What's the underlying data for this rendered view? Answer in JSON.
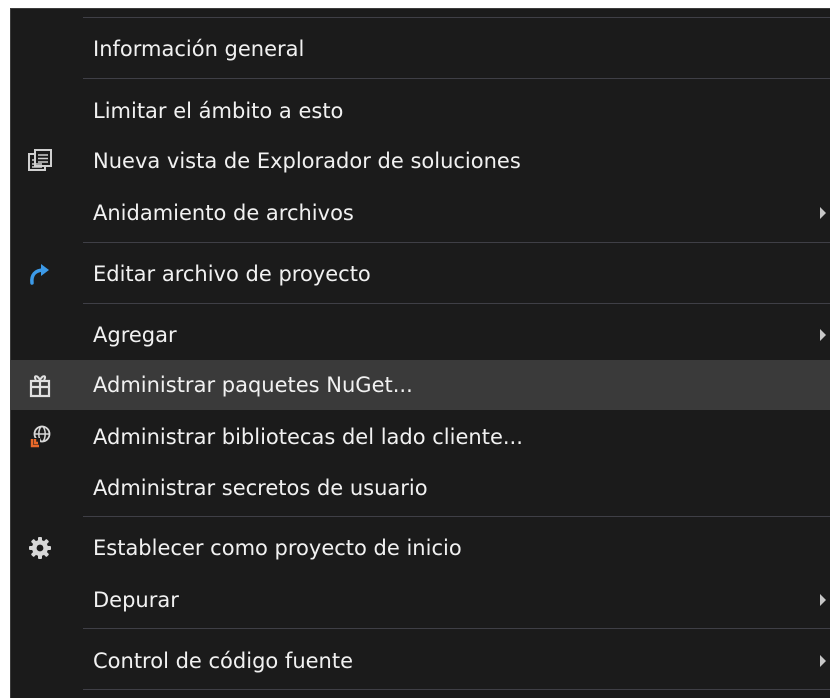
{
  "menu": {
    "items": [
      {
        "label": "Información general"
      },
      {
        "label": "Limitar el ámbito a esto"
      },
      {
        "label": "Nueva vista de Explorador de soluciones",
        "icon": "solution-explorer-view-icon"
      },
      {
        "label": "Anidamiento de archivos",
        "submenu": true
      },
      {
        "label": "Editar archivo de proyecto",
        "icon": "edit-project-arrow-icon"
      },
      {
        "label": "Agregar",
        "submenu": true
      },
      {
        "label": "Administrar paquetes NuGet...",
        "icon": "nuget-package-icon",
        "highlighted": true
      },
      {
        "label": "Administrar bibliotecas del lado cliente...",
        "icon": "client-libraries-icon"
      },
      {
        "label": "Administrar secretos de usuario"
      },
      {
        "label": "Establecer como proyecto de inicio",
        "icon": "gear-icon"
      },
      {
        "label": "Depurar",
        "submenu": true
      },
      {
        "label": "Control de código fuente",
        "submenu": true
      }
    ]
  },
  "colors": {
    "background": "#1b1b1b",
    "highlight": "#3a3a3a",
    "text": "#f1f1f1",
    "separator": "#3f3f46",
    "accent_blue": "#3c9ae8",
    "accent_orange": "#e8692a"
  }
}
